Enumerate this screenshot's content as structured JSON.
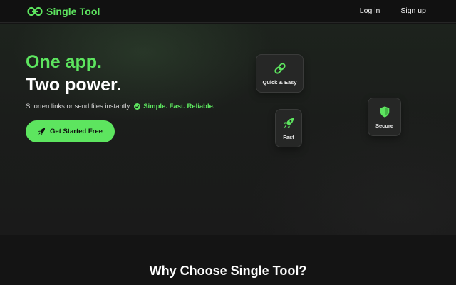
{
  "header": {
    "brand": "Single Tool",
    "nav": {
      "login": "Log in",
      "signup": "Sign up"
    }
  },
  "hero": {
    "headline_line1": "One app.",
    "headline_line2": "Two power.",
    "tagline_text": "Shorten links or send files instantly.",
    "tagline_accent": "Simple. Fast. Reliable.",
    "cta_label": "Get Started Free"
  },
  "features": [
    {
      "label": "Quick & Easy",
      "icon": "link-icon"
    },
    {
      "label": "Fast",
      "icon": "rocket-icon"
    },
    {
      "label": "Secure",
      "icon": "shield-icon"
    }
  ],
  "why": {
    "title": "Why Choose Single Tool?"
  },
  "colors": {
    "accent": "#5de55f",
    "background": "#141414",
    "card": "#262726"
  }
}
